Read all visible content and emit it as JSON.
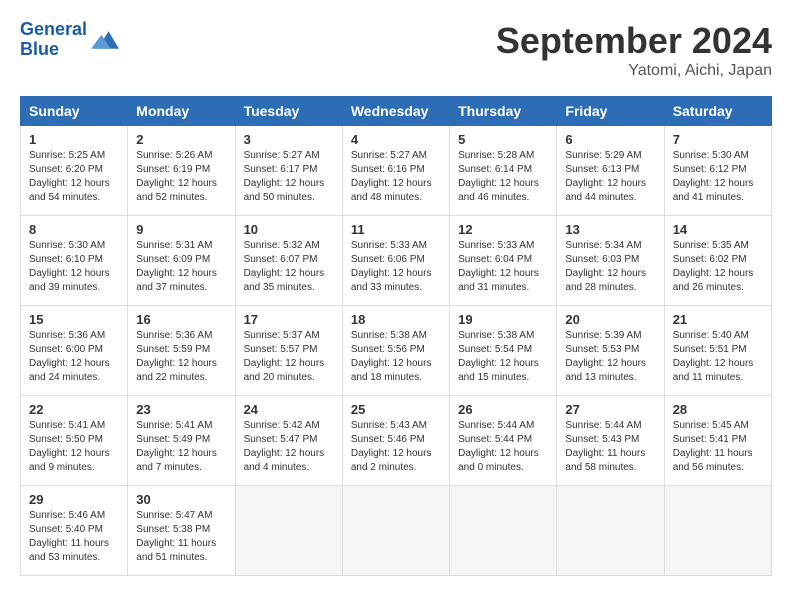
{
  "header": {
    "logo_line1": "General",
    "logo_line2": "Blue",
    "month_title": "September 2024",
    "location": "Yatomi, Aichi, Japan"
  },
  "weekdays": [
    "Sunday",
    "Monday",
    "Tuesday",
    "Wednesday",
    "Thursday",
    "Friday",
    "Saturday"
  ],
  "weeks": [
    [
      {
        "day": "1",
        "sunrise": "5:25 AM",
        "sunset": "6:20 PM",
        "daylight": "12 hours and 54 minutes."
      },
      {
        "day": "2",
        "sunrise": "5:26 AM",
        "sunset": "6:19 PM",
        "daylight": "12 hours and 52 minutes."
      },
      {
        "day": "3",
        "sunrise": "5:27 AM",
        "sunset": "6:17 PM",
        "daylight": "12 hours and 50 minutes."
      },
      {
        "day": "4",
        "sunrise": "5:27 AM",
        "sunset": "6:16 PM",
        "daylight": "12 hours and 48 minutes."
      },
      {
        "day": "5",
        "sunrise": "5:28 AM",
        "sunset": "6:14 PM",
        "daylight": "12 hours and 46 minutes."
      },
      {
        "day": "6",
        "sunrise": "5:29 AM",
        "sunset": "6:13 PM",
        "daylight": "12 hours and 44 minutes."
      },
      {
        "day": "7",
        "sunrise": "5:30 AM",
        "sunset": "6:12 PM",
        "daylight": "12 hours and 41 minutes."
      }
    ],
    [
      {
        "day": "8",
        "sunrise": "5:30 AM",
        "sunset": "6:10 PM",
        "daylight": "12 hours and 39 minutes."
      },
      {
        "day": "9",
        "sunrise": "5:31 AM",
        "sunset": "6:09 PM",
        "daylight": "12 hours and 37 minutes."
      },
      {
        "day": "10",
        "sunrise": "5:32 AM",
        "sunset": "6:07 PM",
        "daylight": "12 hours and 35 minutes."
      },
      {
        "day": "11",
        "sunrise": "5:33 AM",
        "sunset": "6:06 PM",
        "daylight": "12 hours and 33 minutes."
      },
      {
        "day": "12",
        "sunrise": "5:33 AM",
        "sunset": "6:04 PM",
        "daylight": "12 hours and 31 minutes."
      },
      {
        "day": "13",
        "sunrise": "5:34 AM",
        "sunset": "6:03 PM",
        "daylight": "12 hours and 28 minutes."
      },
      {
        "day": "14",
        "sunrise": "5:35 AM",
        "sunset": "6:02 PM",
        "daylight": "12 hours and 26 minutes."
      }
    ],
    [
      {
        "day": "15",
        "sunrise": "5:36 AM",
        "sunset": "6:00 PM",
        "daylight": "12 hours and 24 minutes."
      },
      {
        "day": "16",
        "sunrise": "5:36 AM",
        "sunset": "5:59 PM",
        "daylight": "12 hours and 22 minutes."
      },
      {
        "day": "17",
        "sunrise": "5:37 AM",
        "sunset": "5:57 PM",
        "daylight": "12 hours and 20 minutes."
      },
      {
        "day": "18",
        "sunrise": "5:38 AM",
        "sunset": "5:56 PM",
        "daylight": "12 hours and 18 minutes."
      },
      {
        "day": "19",
        "sunrise": "5:38 AM",
        "sunset": "5:54 PM",
        "daylight": "12 hours and 15 minutes."
      },
      {
        "day": "20",
        "sunrise": "5:39 AM",
        "sunset": "5:53 PM",
        "daylight": "12 hours and 13 minutes."
      },
      {
        "day": "21",
        "sunrise": "5:40 AM",
        "sunset": "5:51 PM",
        "daylight": "12 hours and 11 minutes."
      }
    ],
    [
      {
        "day": "22",
        "sunrise": "5:41 AM",
        "sunset": "5:50 PM",
        "daylight": "12 hours and 9 minutes."
      },
      {
        "day": "23",
        "sunrise": "5:41 AM",
        "sunset": "5:49 PM",
        "daylight": "12 hours and 7 minutes."
      },
      {
        "day": "24",
        "sunrise": "5:42 AM",
        "sunset": "5:47 PM",
        "daylight": "12 hours and 4 minutes."
      },
      {
        "day": "25",
        "sunrise": "5:43 AM",
        "sunset": "5:46 PM",
        "daylight": "12 hours and 2 minutes."
      },
      {
        "day": "26",
        "sunrise": "5:44 AM",
        "sunset": "5:44 PM",
        "daylight": "12 hours and 0 minutes."
      },
      {
        "day": "27",
        "sunrise": "5:44 AM",
        "sunset": "5:43 PM",
        "daylight": "11 hours and 58 minutes."
      },
      {
        "day": "28",
        "sunrise": "5:45 AM",
        "sunset": "5:41 PM",
        "daylight": "11 hours and 56 minutes."
      }
    ],
    [
      {
        "day": "29",
        "sunrise": "5:46 AM",
        "sunset": "5:40 PM",
        "daylight": "11 hours and 53 minutes."
      },
      {
        "day": "30",
        "sunrise": "5:47 AM",
        "sunset": "5:38 PM",
        "daylight": "11 hours and 51 minutes."
      },
      null,
      null,
      null,
      null,
      null
    ]
  ]
}
